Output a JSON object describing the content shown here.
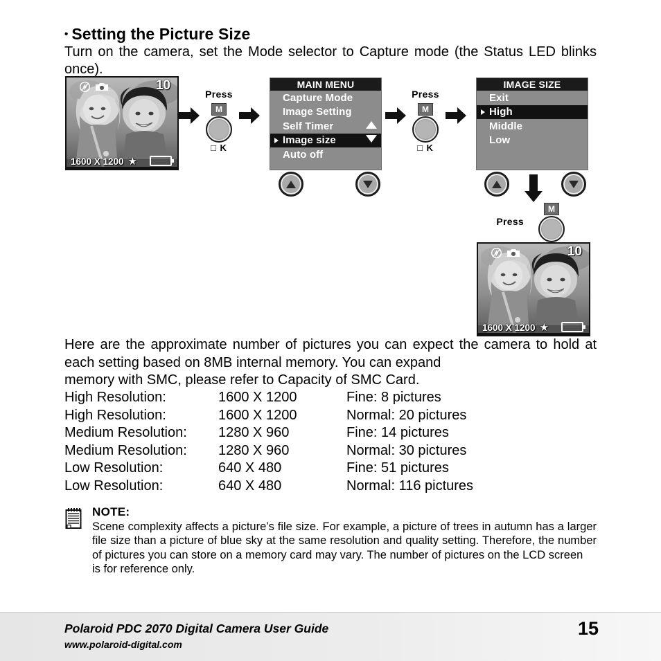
{
  "heading": {
    "bullet": "•",
    "title": "Setting the Picture Size"
  },
  "intro": "Turn on the camera, set the Mode selector to Capture mode (the Status LED blinks once).",
  "diagram": {
    "lcd_left": {
      "count": "10",
      "resolution": "1600 X 1200",
      "star": "★",
      "flash_icon": "flash-off-icon",
      "camera_icon": "camera-icon",
      "battery_icon": "battery-icon"
    },
    "lcd_bottom_right": {
      "count": "10",
      "resolution": "1600 X 1200",
      "star": "★",
      "flash_icon": "flash-off-icon",
      "camera_icon": "camera-icon",
      "battery_icon": "battery-icon"
    },
    "press_1": {
      "label": "Press",
      "mode_key": "M",
      "ok_label": "□ K"
    },
    "press_2": {
      "label": "Press",
      "mode_key": "M",
      "ok_label": "□ K"
    },
    "press_3": {
      "label": "Press",
      "mode_key": "M",
      "ok_label": "□ K"
    },
    "main_menu": {
      "title": "MAIN MENU",
      "items": [
        {
          "label": "Capture Mode",
          "selected": false
        },
        {
          "label": "Image Setting",
          "selected": false
        },
        {
          "label": "Self Timer",
          "selected": false
        },
        {
          "label": "Image size",
          "selected": true
        },
        {
          "label": "Auto off",
          "selected": false
        }
      ]
    },
    "image_size_menu": {
      "title": "IMAGE SIZE",
      "items": [
        {
          "label": "Exit",
          "selected": false
        },
        {
          "label": "High",
          "selected": true
        },
        {
          "label": "Middle",
          "selected": false
        },
        {
          "label": "Low",
          "selected": false
        }
      ]
    },
    "nav_buttons": {
      "menu_up": "up-arrow-button",
      "menu_down": "down-arrow-button",
      "size_up": "up-arrow-button",
      "size_down": "down-arrow-button"
    }
  },
  "paragraph": {
    "text": "Here are the approximate number of pictures you can expect the camera to hold at each setting based on 8MB internal memory. You can expand",
    "last_line": "memory with SMC, please refer to Capacity of SMC Card."
  },
  "capacity_table": {
    "rows": [
      {
        "resolution": "High Resolution:",
        "dimensions": "1600 X 1200",
        "capacity": "Fine: 8 pictures"
      },
      {
        "resolution": "High Resolution:",
        "dimensions": "1600 X 1200",
        "capacity": "Normal: 20 pictures"
      },
      {
        "resolution": "Medium Resolution:",
        "dimensions": "1280 X 960",
        "capacity": "Fine: 14 pictures"
      },
      {
        "resolution": "Medium Resolution:",
        "dimensions": "1280 X 960",
        "capacity": "Normal: 30 pictures"
      },
      {
        "resolution": "Low Resolution:",
        "dimensions": "640 X 480",
        "capacity": "Fine: 51 pictures"
      },
      {
        "resolution": "Low Resolution:",
        "dimensions": "640 X 480",
        "capacity": "Normal: 116 pictures"
      }
    ]
  },
  "note": {
    "icon": "notepad-icon",
    "title": "NOTE:",
    "text": "Scene complexity affects a picture’s file size. For example, a picture of trees in autumn has a larger file size than a picture of blue sky at the same resolution and quality setting. Therefore, the number of pictures you can store on a memory card may vary. The number of pictures on the LCD screen",
    "last_line": "is for reference only."
  },
  "footer": {
    "title": "Polaroid PDC 2070 Digital Camera User Guide",
    "url": "www.polaroid-digital.com",
    "page_number": "15"
  }
}
